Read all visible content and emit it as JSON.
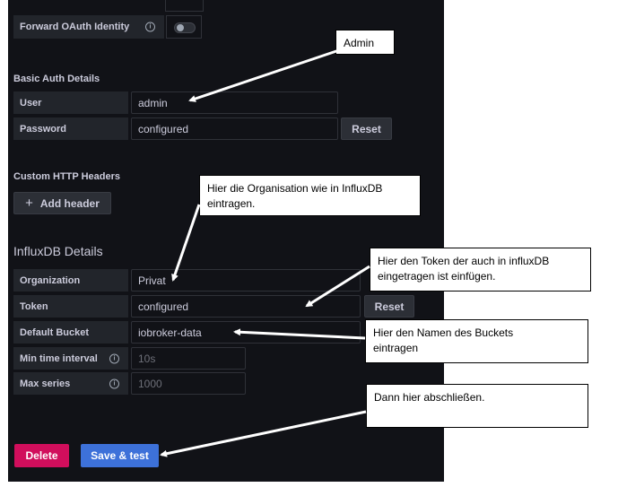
{
  "forward_oauth": {
    "label": "Forward OAuth Identity",
    "info_icon": "info-icon",
    "toggle_on": false
  },
  "basic_auth": {
    "heading": "Basic Auth Details",
    "user_label": "User",
    "user_value": "admin",
    "password_label": "Password",
    "password_value": "configured",
    "reset_label": "Reset"
  },
  "custom_headers": {
    "heading": "Custom HTTP Headers",
    "add_label": "Add header",
    "add_icon": "plus-icon"
  },
  "influx": {
    "heading": "InfluxDB Details",
    "org_label": "Organization",
    "org_value": "Privat",
    "token_label": "Token",
    "token_value": "configured",
    "token_reset_label": "Reset",
    "bucket_label": "Default Bucket",
    "bucket_value": "iobroker-data",
    "min_interval_label": "Min time interval",
    "min_interval_placeholder": "10s",
    "max_series_label": "Max series",
    "max_series_placeholder": "1000"
  },
  "actions": {
    "delete_label": "Delete",
    "save_label": "Save & test"
  },
  "annotations": {
    "admin": "Admin",
    "org_line1": "Hier die Organisation wie in InfluxDB",
    "org_line2": "eintragen.",
    "token_line1": "Hier den Token der auch in influxDB",
    "token_line2": "eingetragen ist einfügen.",
    "bucket_line1": "Hier den Namen des Buckets",
    "bucket_line2": "eintragen",
    "finish": "Dann hier abschließen."
  },
  "colors": {
    "panel_bg": "#111217",
    "delete": "#d10e5c",
    "save": "#3d71d9"
  }
}
